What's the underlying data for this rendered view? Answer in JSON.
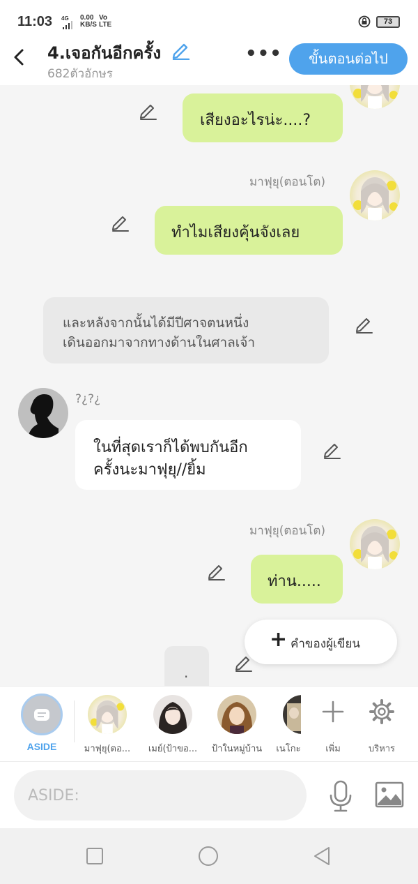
{
  "status_bar": {
    "time": "11:03",
    "network": "4G",
    "speed_value": "0.00",
    "speed_unit": "KB/S",
    "volte_top": "Vo",
    "volte_bottom": "LTE",
    "battery": "73"
  },
  "header": {
    "title": "4.เจอกันอีกครั้ง",
    "char_count": "682ตัวอักษร",
    "more": "•••",
    "next_button": "ขั้นตอนต่อไป"
  },
  "messages": [
    {
      "type": "right",
      "text": "เสียงอะไรน่ะ....?"
    },
    {
      "type": "right",
      "speaker": "มาฟุยุ(ตอนโต)",
      "text": "ทำไมเสียงคุ้นจังเลย"
    },
    {
      "type": "narration",
      "line1": "และหลังจากนั้นได้มีปีศาจตนหนึ่ง",
      "line2": "เดินออกมาจากทางด้านในศาลเจ้า"
    },
    {
      "type": "left",
      "speaker": "?¿?¿",
      "line1": "ในที่สุดเราก็ได้พบกันอีก",
      "line2": "ครั้งนะมาฟุยุ//ยิ้ม"
    },
    {
      "type": "right",
      "speaker": "มาฟุยุ(ตอนโต)",
      "text": "ท่าน....."
    },
    {
      "type": "partial",
      "text": "."
    }
  ],
  "fab": {
    "plus": "+",
    "label": "คำของผู้เขียน"
  },
  "character_bar": {
    "aside_label": "ASIDE",
    "characters": [
      {
        "name": "มาฟุยุ(ตอ..."
      },
      {
        "name": "เมย์(ป้าขอ..."
      },
      {
        "name": "ป้าในหมู่บ้าน"
      },
      {
        "name": "เนโกะ"
      }
    ],
    "add_label": "เพิ่ม",
    "manage_label": "บริหาร"
  },
  "input_bar": {
    "placeholder": "ASIDE:"
  },
  "colors": {
    "accent": "#4fa3ec",
    "bubble_green": "#d9f29a",
    "background": "#f5f5f5"
  },
  "icons": [
    "back-arrow-icon",
    "pencil-icon",
    "more-icon",
    "plus-icon",
    "gear-icon",
    "mic-icon",
    "image-icon",
    "nav-square-icon",
    "nav-circle-icon",
    "nav-triangle-icon"
  ]
}
